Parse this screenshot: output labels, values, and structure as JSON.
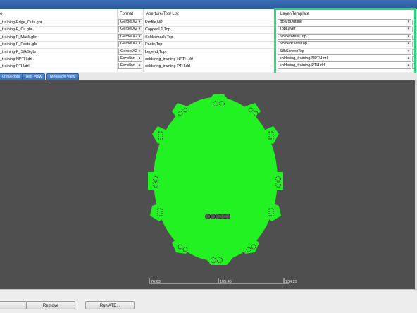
{
  "table": {
    "headers": {
      "file": "e",
      "format": "Format",
      "aperture": "Aperture/Tool List",
      "layer": "Layer/Template"
    },
    "rows": [
      {
        "file": "_training-Edge_Cuts.gbr",
        "format": "GerberX2",
        "aperture": "Profile,NP",
        "layer": "BoardOutline"
      },
      {
        "file": "_training-F_Cu.gbr",
        "format": "GerberX2",
        "aperture": "Copper,L1,Top",
        "layer": "TopLayer"
      },
      {
        "file": "_training-F_Mask.gbr",
        "format": "GerberX2",
        "aperture": "Soldermask,Top",
        "layer": "SolderMaskTop"
      },
      {
        "file": "_training-F_Paste.gbr",
        "format": "GerberX2",
        "aperture": "Paste,Top",
        "layer": "SolderPasteTop"
      },
      {
        "file": "_training-F_SilkS.gbr",
        "format": "GerberX2",
        "aperture": "Legend,Top",
        "layer": "SilkScreenTop"
      },
      {
        "file": "_training-NPTH.drl",
        "format": "Excellon",
        "aperture": "soldering_training-NPTH.drl",
        "layer": "soldering_training-NPTH.drl"
      },
      {
        "file": "_training-PTH.drl",
        "format": "Excellon",
        "aperture": "soldering_training-PTH.drl",
        "layer": "soldering_training-PTH.drl"
      }
    ]
  },
  "tabs": {
    "apertures": "ures/Tools",
    "text_view": "Text View",
    "message_view": "Message View"
  },
  "ruler": {
    "labels": [
      "76.63",
      "105.46",
      "134.29"
    ]
  },
  "buttons": {
    "left": "",
    "remove": "Remove",
    "run_ate": "Run ATE..."
  },
  "colors": {
    "board_fill": "#22f222",
    "viewer_bg": "#4f4f4f",
    "highlight": "#2fd27a"
  }
}
